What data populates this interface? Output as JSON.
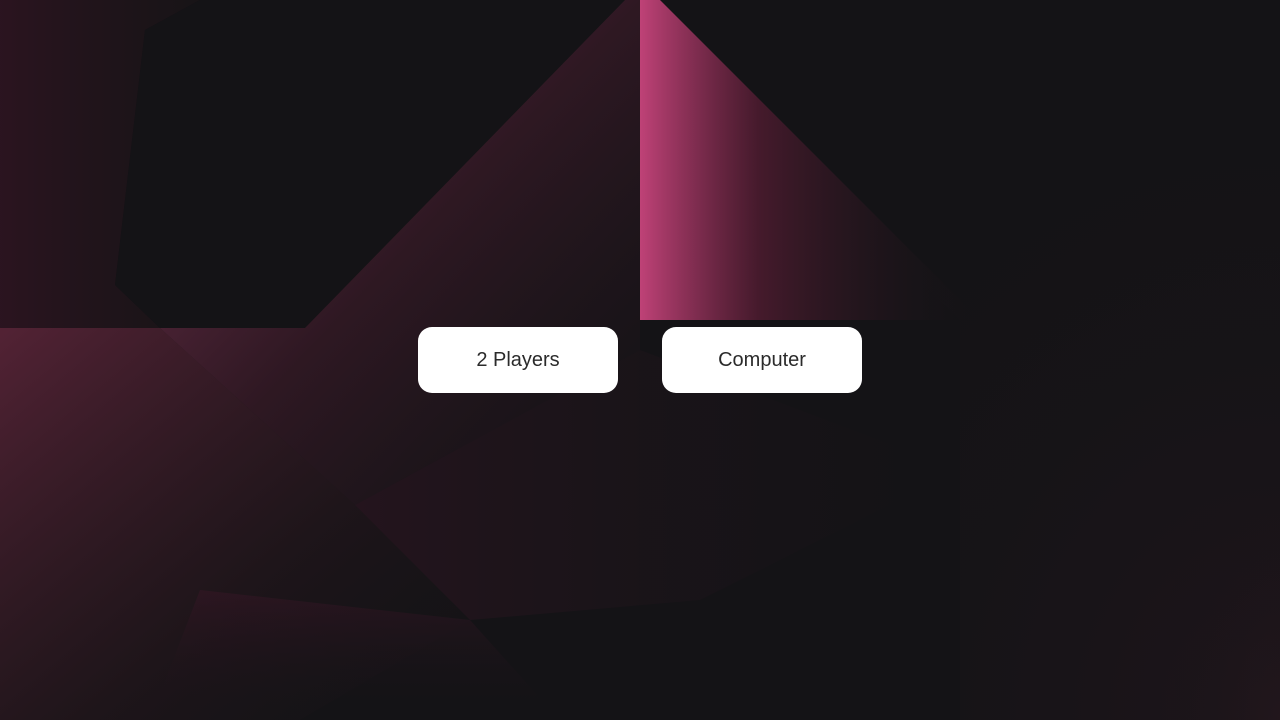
{
  "menu": {
    "two_players_label": "2 Players",
    "computer_label": "Computer"
  },
  "theme": {
    "background": "#141316",
    "accent": "#c8447c",
    "button_background": "#ffffff",
    "button_text": "#2b2b2b"
  }
}
